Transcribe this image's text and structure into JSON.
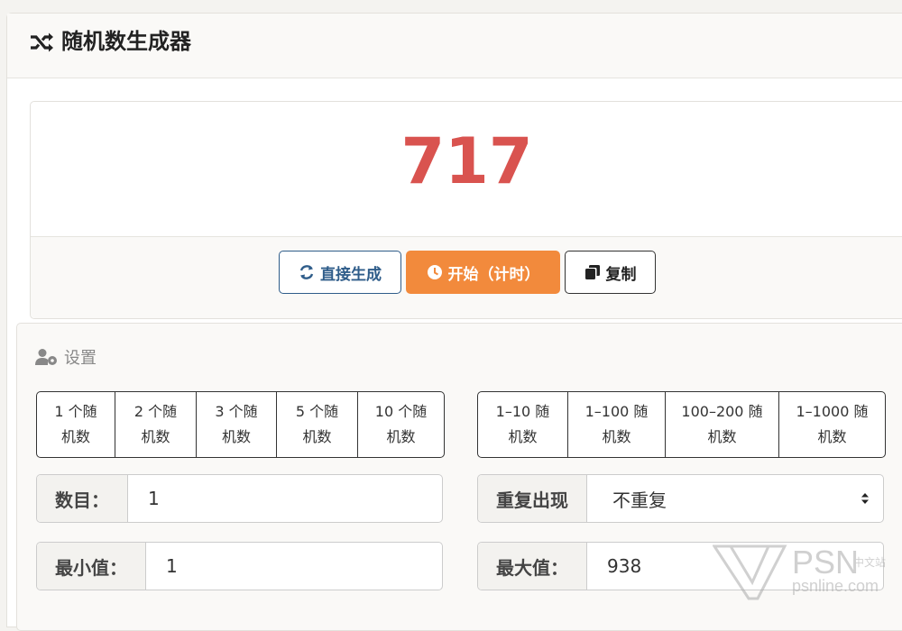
{
  "header": {
    "title": "随机数生成器",
    "icon": "shuffle-icon"
  },
  "result": {
    "value": "717",
    "color": "#d9534f"
  },
  "actions": {
    "generate_label": "直接生成",
    "start_label": "开始（计时）",
    "copy_label": "复制"
  },
  "settings": {
    "title": "设置",
    "count_presets": [
      "1 个随\n机数",
      "2 个随\n机数",
      "3 个随\n机数",
      "5 个随\n机数",
      "10 个随\n机数"
    ],
    "range_presets": [
      "1–10 随\n机数",
      "1–100 随\n机数",
      "100–200 随\n机数",
      "1–1000 随\n机数"
    ],
    "count_label": "数目：",
    "count_value": "1",
    "repeat_label": "重复出现",
    "repeat_value": "不重复",
    "min_label": "最小值：",
    "min_value": "1",
    "max_label": "最大值：",
    "max_value": "938"
  },
  "watermark": {
    "main": "PSN",
    "sub": "中文站",
    "url": "psnline.com"
  },
  "colors": {
    "accent_orange": "#f28a3c",
    "accent_blue": "#2f5d8a",
    "result_red": "#d9534f"
  }
}
